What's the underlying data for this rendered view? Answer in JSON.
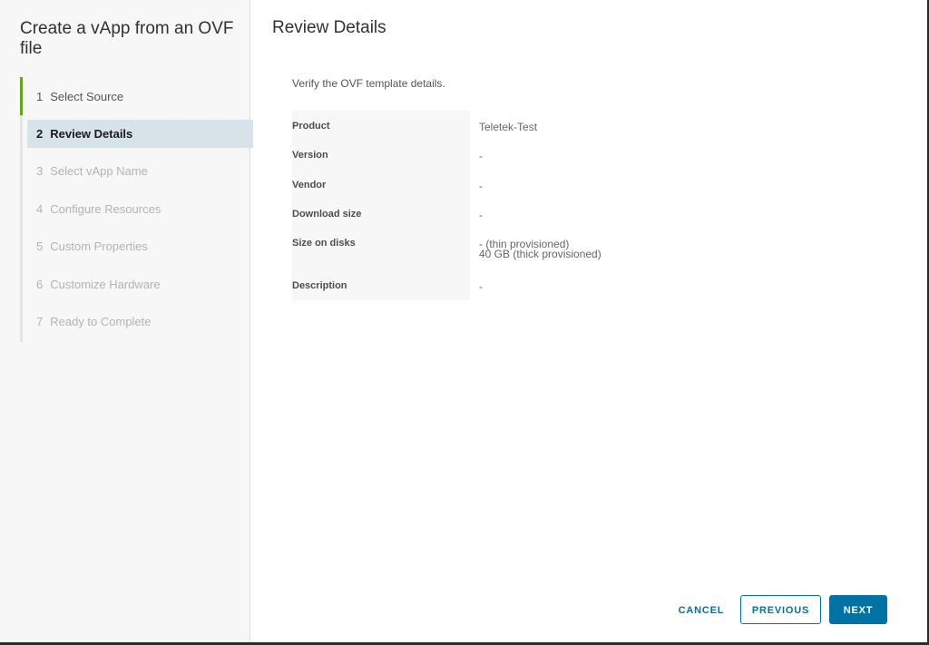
{
  "wizard": {
    "title": "Create a vApp from an OVF file",
    "steps": [
      {
        "number": "1",
        "label": "Select Source",
        "state": "completed"
      },
      {
        "number": "2",
        "label": "Review Details",
        "state": "active"
      },
      {
        "number": "3",
        "label": "Select vApp Name",
        "state": "disabled"
      },
      {
        "number": "4",
        "label": "Configure Resources",
        "state": "disabled"
      },
      {
        "number": "5",
        "label": "Custom Properties",
        "state": "disabled"
      },
      {
        "number": "6",
        "label": "Customize Hardware",
        "state": "disabled"
      },
      {
        "number": "7",
        "label": "Ready to Complete",
        "state": "disabled"
      }
    ]
  },
  "main": {
    "title": "Review Details",
    "subtitle": "Verify the OVF template details.",
    "details": {
      "product": {
        "label": "Product",
        "value": "Teletek-Test"
      },
      "version": {
        "label": "Version",
        "value": "-"
      },
      "vendor": {
        "label": "Vendor",
        "value": "-"
      },
      "download_size": {
        "label": "Download size",
        "value": "-"
      },
      "size_on_disks": {
        "label": "Size on disks",
        "value_line1": "- (thin provisioned)",
        "value_line2": "40 GB (thick provisioned)"
      },
      "description": {
        "label": "Description",
        "value": "-"
      }
    }
  },
  "footer": {
    "cancel_label": "CANCEL",
    "previous_label": "PREVIOUS",
    "next_label": "NEXT"
  },
  "colors": {
    "accent": "#0072a3",
    "progress": "#62a420",
    "active_step_bg": "#d8e3e9",
    "sidebar_bg": "#f7f7f7"
  }
}
